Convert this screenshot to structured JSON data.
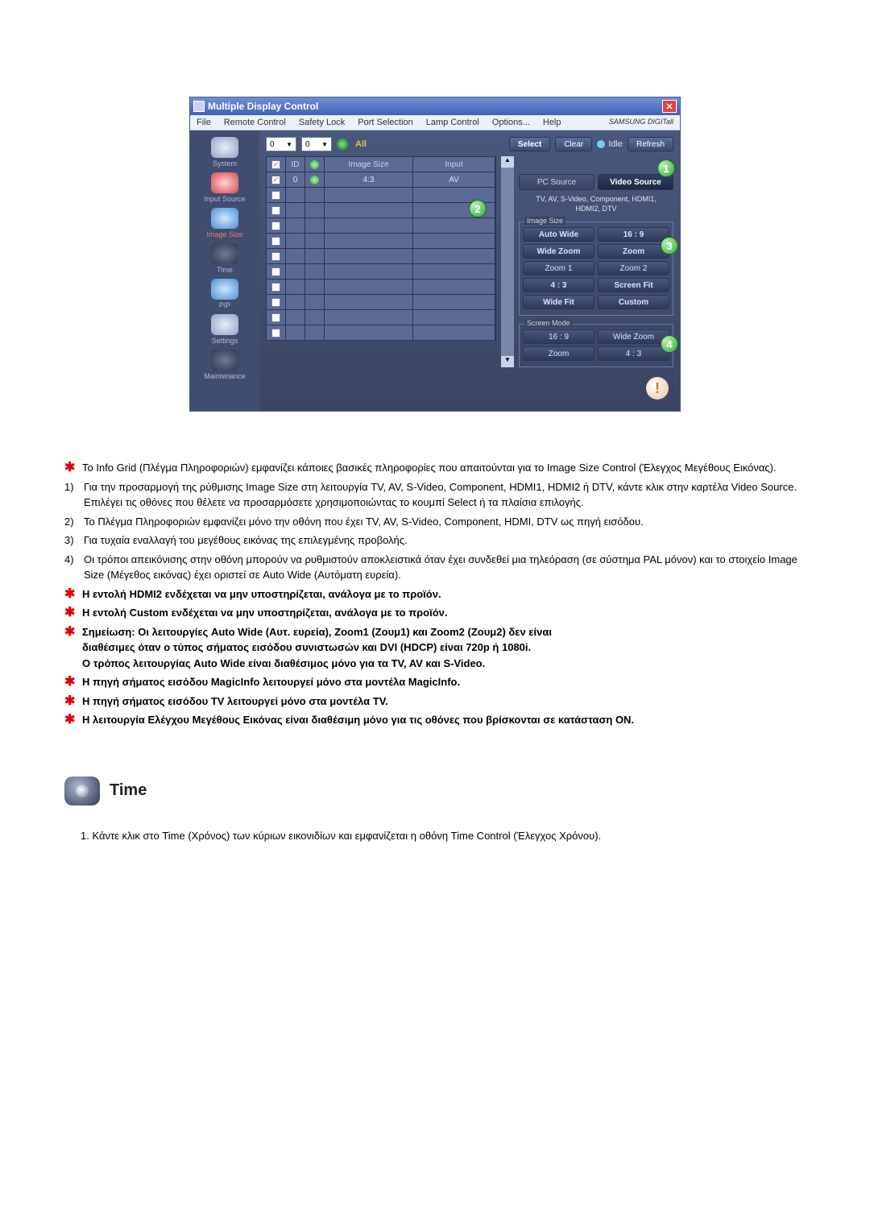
{
  "window": {
    "title": "Multiple Display Control",
    "menu": [
      "File",
      "Remote Control",
      "Safety Lock",
      "Port Selection",
      "Lamp Control",
      "Options...",
      "Help"
    ],
    "brand": "SAMSUNG DIGITall"
  },
  "sidebar": [
    {
      "label": "System"
    },
    {
      "label": "Input Source"
    },
    {
      "label": "Image Size",
      "active": true
    },
    {
      "label": "Time"
    },
    {
      "label": "PIP"
    },
    {
      "label": "Settings"
    },
    {
      "label": "Maintenance"
    }
  ],
  "top": {
    "d1": "0",
    "d2": "0",
    "all": "All",
    "select": "Select",
    "clear": "Clear",
    "idle": "Idle",
    "refresh": "Refresh"
  },
  "grid": {
    "cols": {
      "id": "ID",
      "size": "Image Size",
      "input": "Input"
    },
    "row": {
      "id": "0",
      "size": "4:3",
      "input": "AV"
    }
  },
  "rpanel": {
    "tab_pc": "PC Source",
    "tab_vid": "Video Source",
    "srcinfo1": "TV, AV, S-Video, Component, HDMI1,",
    "srcinfo2": "HDMI2, DTV",
    "legend1": "Image Size",
    "b11": "Auto Wide",
    "b12": "16 : 9",
    "b21": "Wide Zoom",
    "b22": "Zoom",
    "b31": "Zoom 1",
    "b32": "Zoom 2",
    "b41": "4 : 3",
    "b42": "Screen Fit",
    "b51": "Wide Fit",
    "b52": "Custom",
    "legend2": "Screen Mode",
    "b61": "16 : 9",
    "b62": "Wide Zoom",
    "b71": "Zoom",
    "b72": "4 : 3"
  },
  "callouts": {
    "c1": "1",
    "c2": "2",
    "c3": "3",
    "c4": "4"
  },
  "text": {
    "star1": "Το Info Grid (Πλέγμα Πληροφοριών) εμφανίζει κάποιες βασικές πληροφορίες που απαιτούνται για το Image Size Control (Έλεγχος Μεγέθους Εικόνας).",
    "n1a": "Για την προσαρμογή της ρύθμισης Image Size στη λειτουργία TV, AV, S-Video, Component, HDMI1, HDMI2 ή DTV, κάντε κλικ στην καρτέλα Video Source.",
    "n1b": "Επιλέγει τις οθόνες που θέλετε να προσαρμόσετε χρησιμοποιώντας το κουμπί Select ή τα πλαίσια επιλογής.",
    "n2": "Το Πλέγμα Πληροφοριών εμφανίζει μόνο την οθόνη που έχει TV, AV, S-Video, Component, HDMI, DTV ως πηγή εισόδου.",
    "n3": "Για τυχαία εναλλαγή του μεγέθους εικόνας της επιλεγμένης προβολής.",
    "n4": "Οι τρόποι απεικόνισης στην οθόνη μπορούν να ρυθμιστούν αποκλειστικά όταν έχει συνδεθεί μια τηλεόραση (σε σύστημα PAL μόνον) και το στοιχείο Image Size (Μέγεθος εικόνας) έχει οριστεί σε Auto Wide (Αυτόματη ευρεία).",
    "s2": "Η εντολή HDMI2 ενδέχεται να μην υποστηρίζεται, ανάλογα με το προϊόν.",
    "s3": "Η εντολή Custom ενδέχεται να μην υποστηρίζεται, ανάλογα με το προϊόν.",
    "s4a": "Σημείωση: Οι λειτουργίες Auto Wide (Αυτ. ευρεία), Zoom1 (Ζουμ1) και Zoom2 (Ζουμ2) δεν είναι",
    "s4b": "διαθέσιμες όταν ο τύπος σήματος εισόδου συνιστωσών και DVI (HDCP) είναι 720p ή 1080i.",
    "s4c": "Ο τρόπος λειτουργίας Auto Wide είναι διαθέσιμος μόνο για τα TV, AV και S-Video.",
    "s5": "Η πηγή σήματος εισόδου MagicInfo λειτουργεί μόνο στα μοντέλα MagicInfo.",
    "s6": "Η πηγή σήματος εισόδου TV λειτουργεί μόνο στα μοντέλα TV.",
    "s7": "Η λειτουργία Ελέγχου Μεγέθους Εικόνας είναι διαθέσιμη μόνο για τις οθόνες που βρίσκονται σε κατάσταση ON."
  },
  "time": {
    "title": "Time",
    "item1": "1.  Κάντε κλικ στο Time (Χρόνος) των κύριων εικονιδίων και εμφανίζεται η οθόνη Time Control (Έλεγχος Χρόνου)."
  }
}
